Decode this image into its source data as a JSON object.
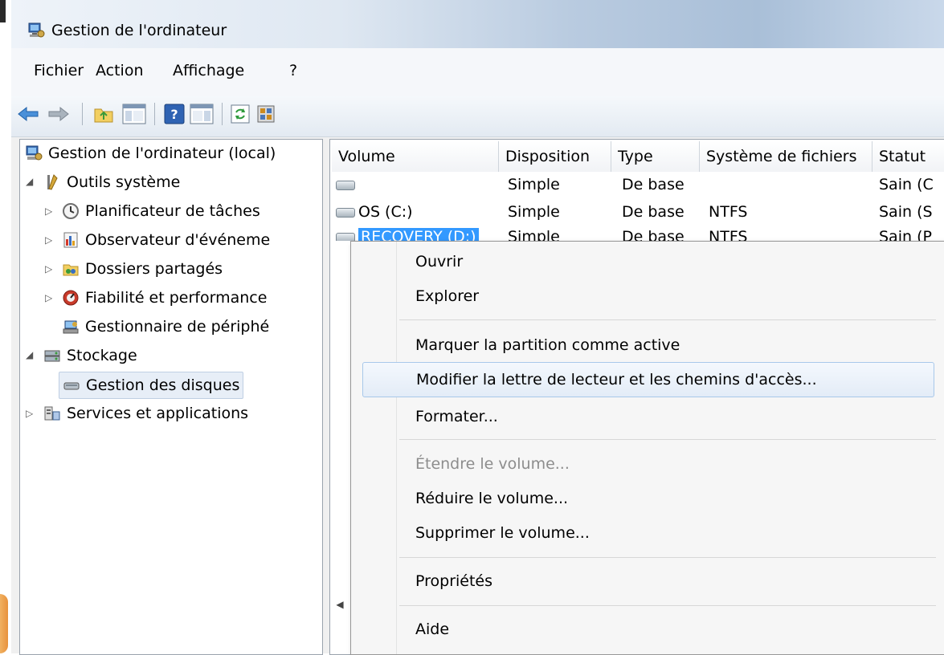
{
  "window": {
    "title": "Gestion de l'ordinateur"
  },
  "menubar": {
    "items": [
      "Fichier",
      "Action",
      "Affichage",
      "?"
    ]
  },
  "toolbar": {
    "icons": [
      "back-arrow-icon",
      "forward-arrow-icon",
      "up-folder-icon",
      "show-hide-tree-icon",
      "help-icon",
      "show-hide-action-pane-icon",
      "refresh-icon",
      "properties-icon"
    ]
  },
  "tree": {
    "root": "Gestion de l'ordinateur (local)",
    "outils": "Outils système",
    "planificateur": "Planificateur de tâches",
    "observateur": "Observateur d'événeme",
    "dossiers": "Dossiers partagés",
    "fiabilite": "Fiabilité et performance",
    "gestionnaire": "Gestionnaire de périphé",
    "stockage": "Stockage",
    "disques": "Gestion des disques",
    "services": "Services et applications"
  },
  "table": {
    "headers": [
      "Volume",
      "Disposition",
      "Type",
      "Système de fichiers",
      "Statut"
    ],
    "rows": [
      {
        "volume": "",
        "disposition": "Simple",
        "type": "De base",
        "fs": "",
        "statut": "Sain (C"
      },
      {
        "volume": "OS (C:)",
        "disposition": "Simple",
        "type": "De base",
        "fs": "NTFS",
        "statut": "Sain (S"
      },
      {
        "volume": "RECOVERY (D:)",
        "disposition": "Simple",
        "type": "De base",
        "fs": "NTFS",
        "statut": "Sain (P"
      }
    ]
  },
  "context_menu": {
    "items": [
      {
        "label": "Ouvrir",
        "enabled": true
      },
      {
        "label": "Explorer",
        "enabled": true
      },
      {
        "label": "Marquer la partition comme active",
        "enabled": true
      },
      {
        "label": "Modifier la lettre de lecteur et les chemins d'accès...",
        "enabled": true,
        "highlighted": true
      },
      {
        "label": "Formater...",
        "enabled": true
      },
      {
        "label": "Étendre le volume...",
        "enabled": false
      },
      {
        "label": "Réduire le volume...",
        "enabled": true
      },
      {
        "label": "Supprimer le volume...",
        "enabled": true
      },
      {
        "label": "Propriétés",
        "enabled": true
      },
      {
        "label": "Aide",
        "enabled": true
      }
    ]
  },
  "colors": {
    "selection": "#3399ff",
    "menu_highlight_border": "#a8c8ea",
    "disabled_text": "#8d8d8d"
  }
}
